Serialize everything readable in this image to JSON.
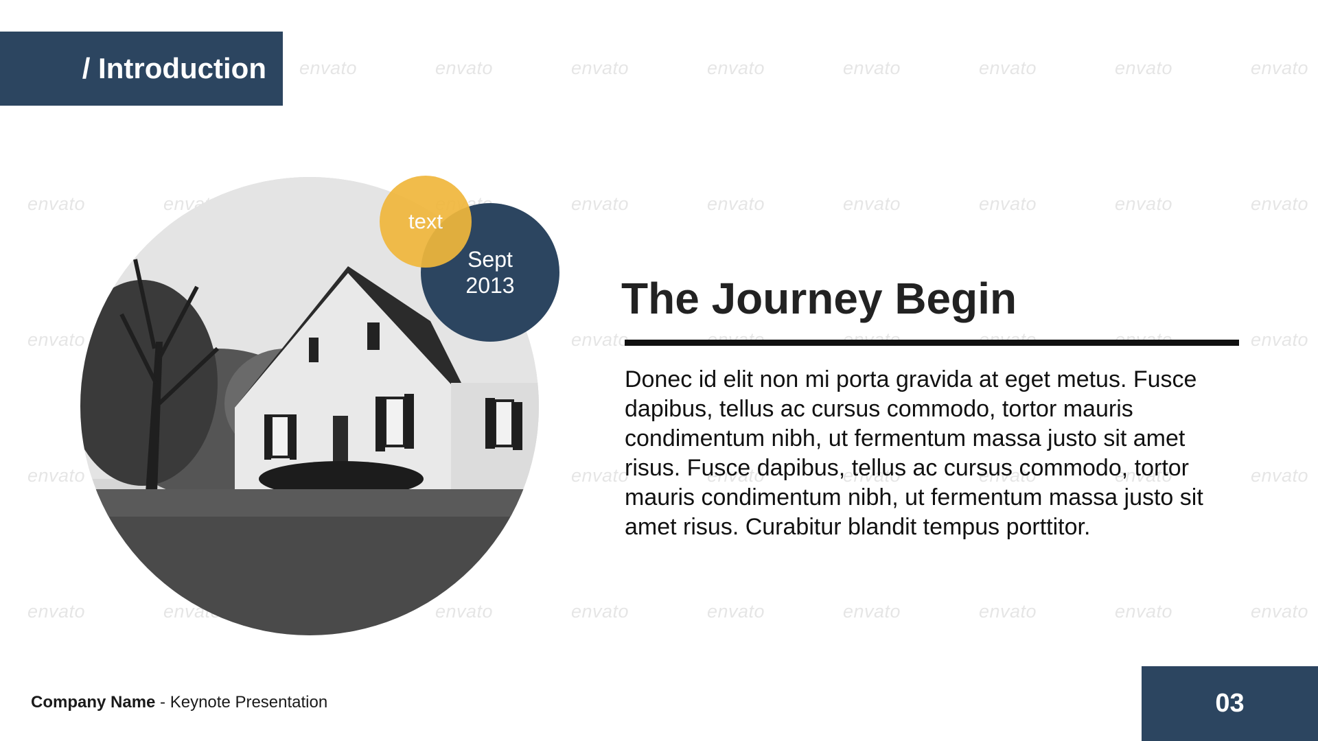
{
  "colors": {
    "navy": "#2c4560",
    "yellow": "#f0b73c",
    "title_text": "#222222"
  },
  "header": {
    "section_title": "/ Introduction"
  },
  "photo": {
    "description_icon": "house-photo"
  },
  "bubbles": {
    "small_label": "text",
    "date_line1": "Sept",
    "date_line2": "2013"
  },
  "content": {
    "title": "The Journey Begin",
    "body": "Donec id elit non mi porta gravida at eget metus. Fusce dapibus, tellus ac cursus commodo, tortor mauris condimentum nibh, ut fermentum massa justo sit amet risus. Fusce dapibus, tellus ac cursus commodo, tortor mauris condimentum nibh, ut fermentum massa justo sit amet risus. Curabitur blandit tempus porttitor."
  },
  "footer": {
    "company": "Company Name",
    "separator": " - ",
    "subtitle": "Keynote Presentation",
    "page_number": "03"
  },
  "watermark": {
    "text": "envato"
  }
}
